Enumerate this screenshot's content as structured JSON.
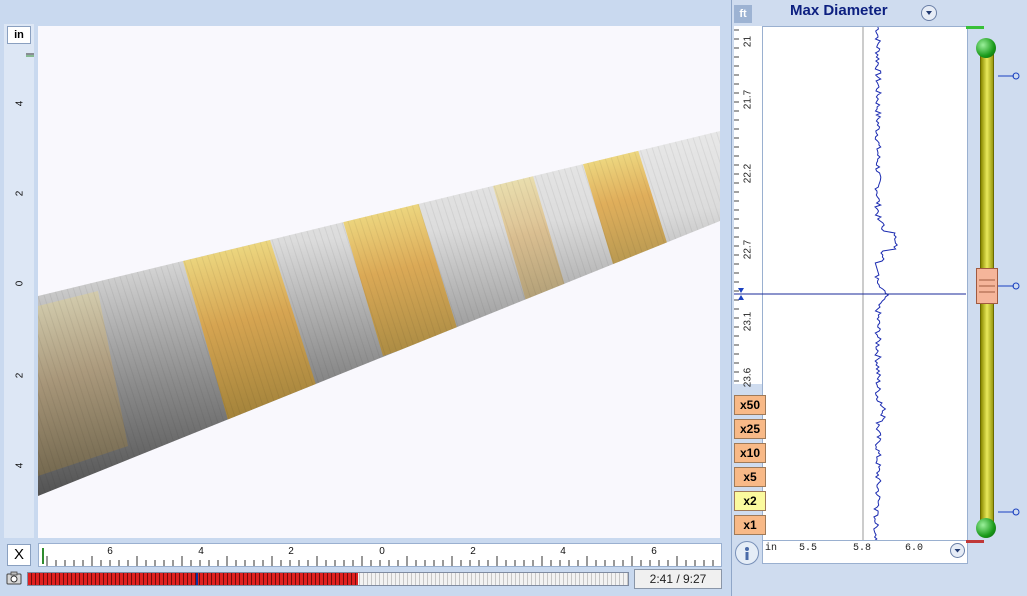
{
  "left_ruler": {
    "unit": "in",
    "ticks": [
      "4",
      "2",
      "0",
      "2",
      "4"
    ]
  },
  "bottom_ruler": {
    "ticks": [
      "6",
      "4",
      "2",
      "0",
      "2",
      "4",
      "6"
    ]
  },
  "close_label": "X",
  "playback": {
    "time": "2:41 / 9:27",
    "progress": 0.28,
    "secondary_progress": 0.55
  },
  "right": {
    "depth_unit": "ft",
    "title": "Max Diameter",
    "depth_ticks": [
      "21",
      "21.7",
      "22.2",
      "22.7",
      "23.1",
      "23.6"
    ],
    "x_axis": {
      "unit": "in",
      "ticks": [
        "5.5",
        "5.8",
        "6.0"
      ]
    },
    "zoom_buttons": [
      "x50",
      "x25",
      "x10",
      "x5",
      "x2",
      "x1"
    ],
    "active_zoom": "x2"
  },
  "colors": {
    "coating_yellow": "#e6c437",
    "trace_blue": "#1a2ab0",
    "slider_yellow": "#e0e050",
    "progress_red": "#cc2020"
  }
}
